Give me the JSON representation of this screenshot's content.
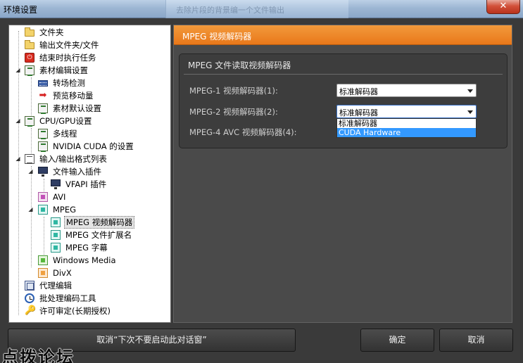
{
  "window": {
    "title": "环境设置",
    "close_glyph": "✕",
    "background_window_title": "去除片段的背景编一个文件输出"
  },
  "tree": {
    "items": [
      {
        "label": "文件夹",
        "icon": "folder-icon"
      },
      {
        "label": "输出文件夹/文件",
        "icon": "folder-icon"
      },
      {
        "label": "结束时执行任务",
        "icon": "power-icon"
      },
      {
        "label": "素材编辑设置",
        "icon": "settings-doc-icon"
      },
      {
        "label": "转场检测",
        "icon": "film-icon"
      },
      {
        "label": "预览移动量",
        "icon": "arrow-right-icon"
      },
      {
        "label": "素材默认设置",
        "icon": "settings-doc-icon"
      },
      {
        "label": "CPU/GPU设置",
        "icon": "settings-doc-icon"
      },
      {
        "label": "多线程",
        "icon": "settings-doc-icon"
      },
      {
        "label": "NVIDIA CUDA 的设置",
        "icon": "settings-doc-icon"
      },
      {
        "label": "输入/输出格式列表",
        "icon": "list-icon"
      },
      {
        "label": "文件输入插件",
        "icon": "monitor-icon"
      },
      {
        "label": "VFAPI 插件",
        "icon": "monitor-icon"
      },
      {
        "label": "AVI",
        "icon": "avi-icon"
      },
      {
        "label": "MPEG",
        "icon": "mpeg-icon"
      },
      {
        "label": "MPEG 视频解码器",
        "icon": "mpeg-icon"
      },
      {
        "label": "MPEG 文件扩展名",
        "icon": "mpeg-icon"
      },
      {
        "label": "MPEG 字幕",
        "icon": "mpeg-icon"
      },
      {
        "label": "Windows Media",
        "icon": "wmv-icon"
      },
      {
        "label": "DivX",
        "icon": "divx-icon"
      },
      {
        "label": "代理编辑",
        "icon": "proxy-icon"
      },
      {
        "label": "批处理编码工具",
        "icon": "clock-icon"
      },
      {
        "label": "许可审定(长期授权)",
        "icon": "key-icon"
      }
    ],
    "toggle_expanded": "◢",
    "power_glyph": "⏻",
    "arrow_glyph": "➡",
    "key_glyph": "🔑"
  },
  "panel": {
    "header": "MPEG 视频解码器",
    "group_title": "MPEG 文件读取视频解码器",
    "rows": [
      {
        "label": "MPEG-1 视频解码器(1):",
        "value": "标准解码器"
      },
      {
        "label": "MPEG-2 视频解码器(2):",
        "value": "标准解码器"
      },
      {
        "label": "MPEG-4 AVC 视频解码器(4):",
        "value": ""
      }
    ],
    "dropdown_options": [
      "标准解码器",
      "CUDA Hardware"
    ]
  },
  "buttons": {
    "dont_show": "取消“下次不要启动此对话窗”",
    "ok": "确定",
    "cancel": "取消"
  },
  "watermark": "点拨论坛",
  "colors": {
    "header_orange": "#ee8a2c",
    "selection_blue": "#3399ff",
    "dialog_bg": "#3a3a3a"
  }
}
